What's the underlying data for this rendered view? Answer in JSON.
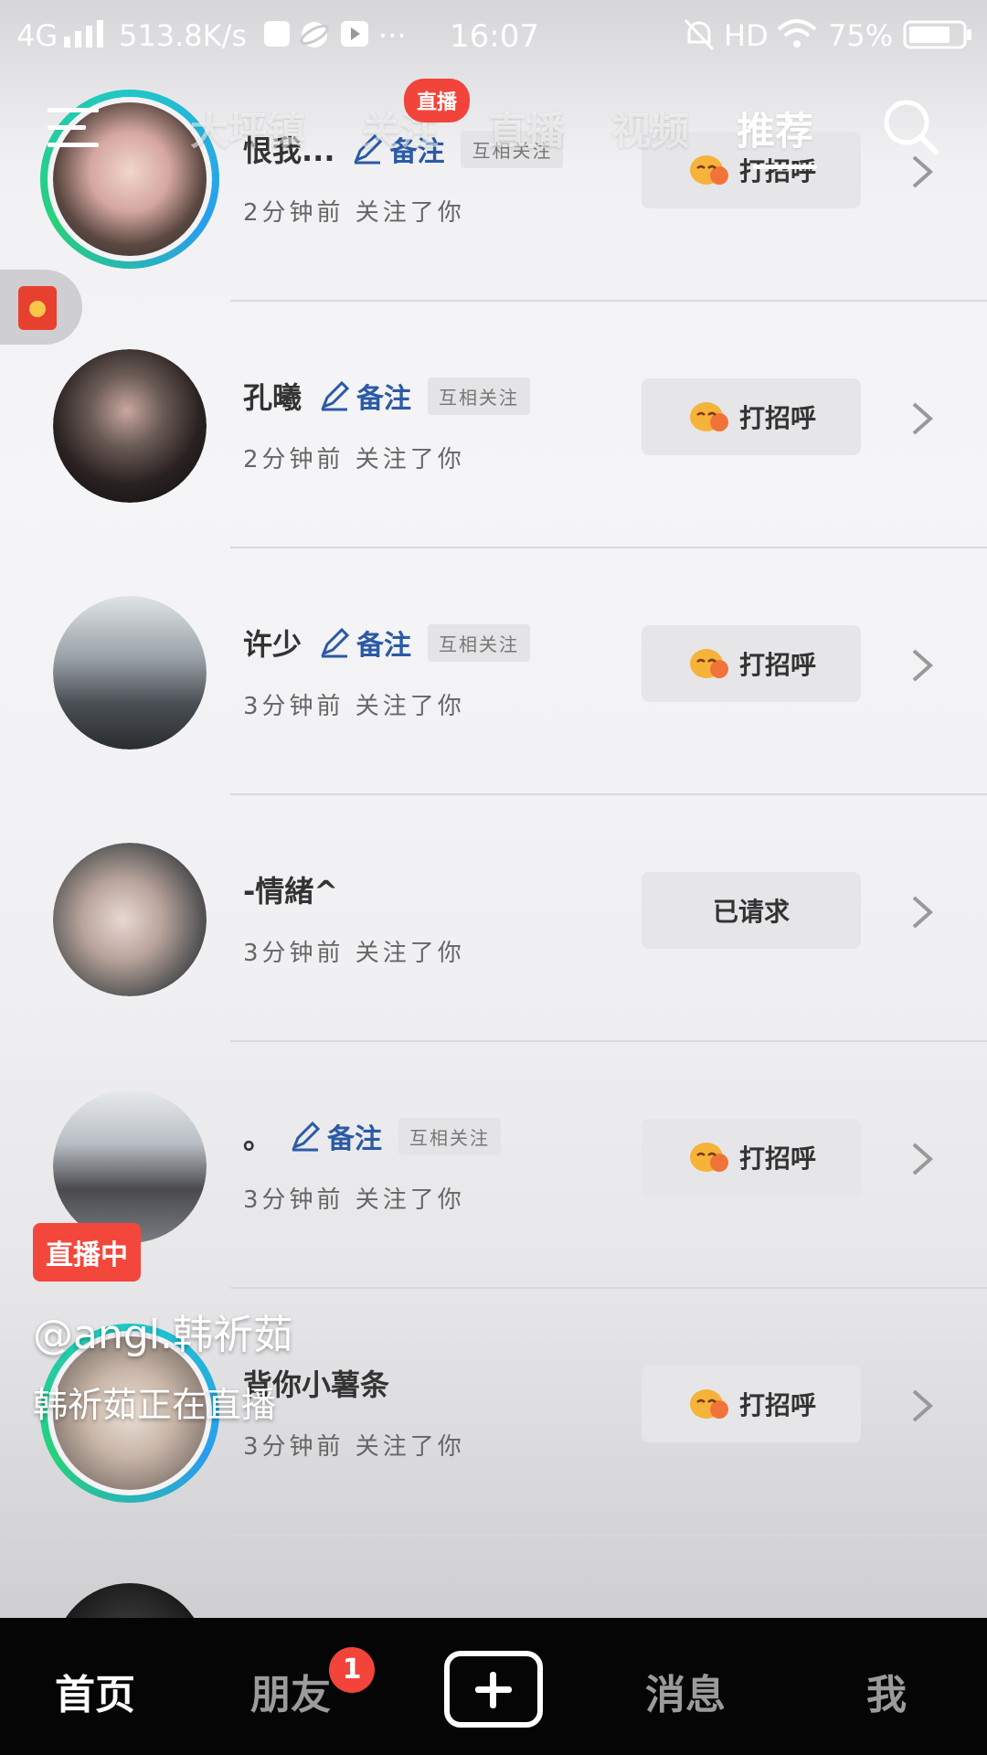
{
  "status_bar": {
    "network": "4G",
    "speed": "513.8K/s",
    "time": "16:07",
    "hd": "HD",
    "battery": "75%",
    "more": "···"
  },
  "top_nav": {
    "tabs": [
      "大坪镇",
      "关注",
      "直播",
      "视频",
      "推荐"
    ],
    "active": "推荐",
    "live_pill": "直播"
  },
  "list": [
    {
      "name": "恨我...",
      "note": "备注",
      "mutual": "互相关注",
      "sub": "2分钟前  关注了你",
      "action": "打招呼"
    },
    {
      "name": "孔曦",
      "note": "备注",
      "mutual": "互相关注",
      "sub": "2分钟前  关注了你",
      "action": "打招呼"
    },
    {
      "name": "许少",
      "note": "备注",
      "mutual": "互相关注",
      "sub": "3分钟前  关注了你",
      "action": "打招呼"
    },
    {
      "name": "-情緒^",
      "note": "",
      "mutual": "",
      "sub": "3分钟前  关注了你",
      "action": "已请求"
    },
    {
      "name": "。",
      "note": "备注",
      "mutual": "互相关注",
      "sub": "3分钟前  关注了你",
      "action": "打招呼"
    },
    {
      "name": "背你小薯条",
      "note": "",
      "mutual": "",
      "sub": "3分钟前  关注了你",
      "action": "打招呼"
    }
  ],
  "live_overlay": {
    "badge": "直播中",
    "user": "@angl.韩祈茹",
    "desc": "韩祈茹正在直播"
  },
  "bottom_nav": {
    "home": "首页",
    "friends": "朋友",
    "friends_badge": "1",
    "messages": "消息",
    "me": "我"
  },
  "colors": {
    "live_red": "#f2443a",
    "note_blue": "#2b5aa6",
    "bottom_bar": "#050505"
  },
  "icons": [
    "menu-icon",
    "search-icon",
    "pencil-icon",
    "smile-emoji-icon",
    "chevron-right-icon",
    "plus-icon",
    "red-packet-icon"
  ]
}
